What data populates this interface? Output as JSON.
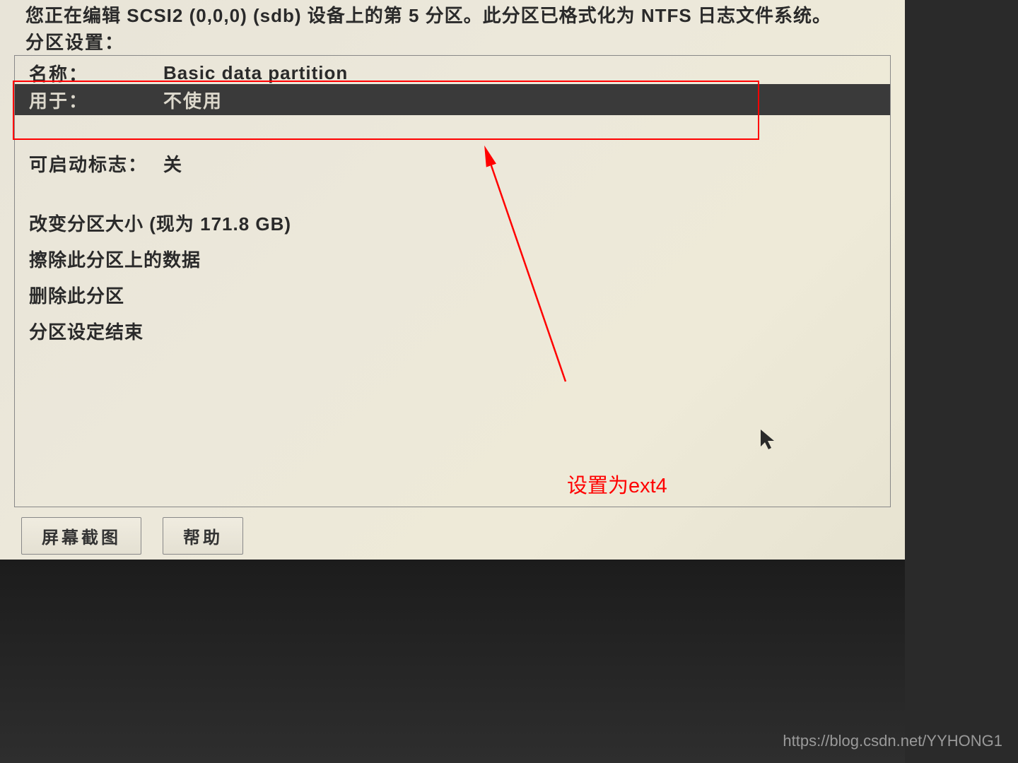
{
  "header": {
    "line1": "您正在编辑 SCSI2 (0,0,0) (sdb) 设备上的第 5 分区。此分区已格式化为 NTFS 日志文件系统。",
    "line2": "分区设置："
  },
  "rows": {
    "name_label": "名称：",
    "name_value": "Basic data partition",
    "useas_label": "用于：",
    "useas_value": "不使用",
    "bootflag_label": "可启动标志：",
    "bootflag_value": "关"
  },
  "actions": {
    "resize": "改变分区大小 (现为 171.8 GB)",
    "erase": "擦除此分区上的数据",
    "delete": "删除此分区",
    "done": "分区设定结束"
  },
  "buttons": {
    "screenshot": "屏幕截图",
    "help": "帮助"
  },
  "annotation": {
    "hint": "设置为ext4"
  },
  "watermark": "https://blog.csdn.net/YYHONG1"
}
